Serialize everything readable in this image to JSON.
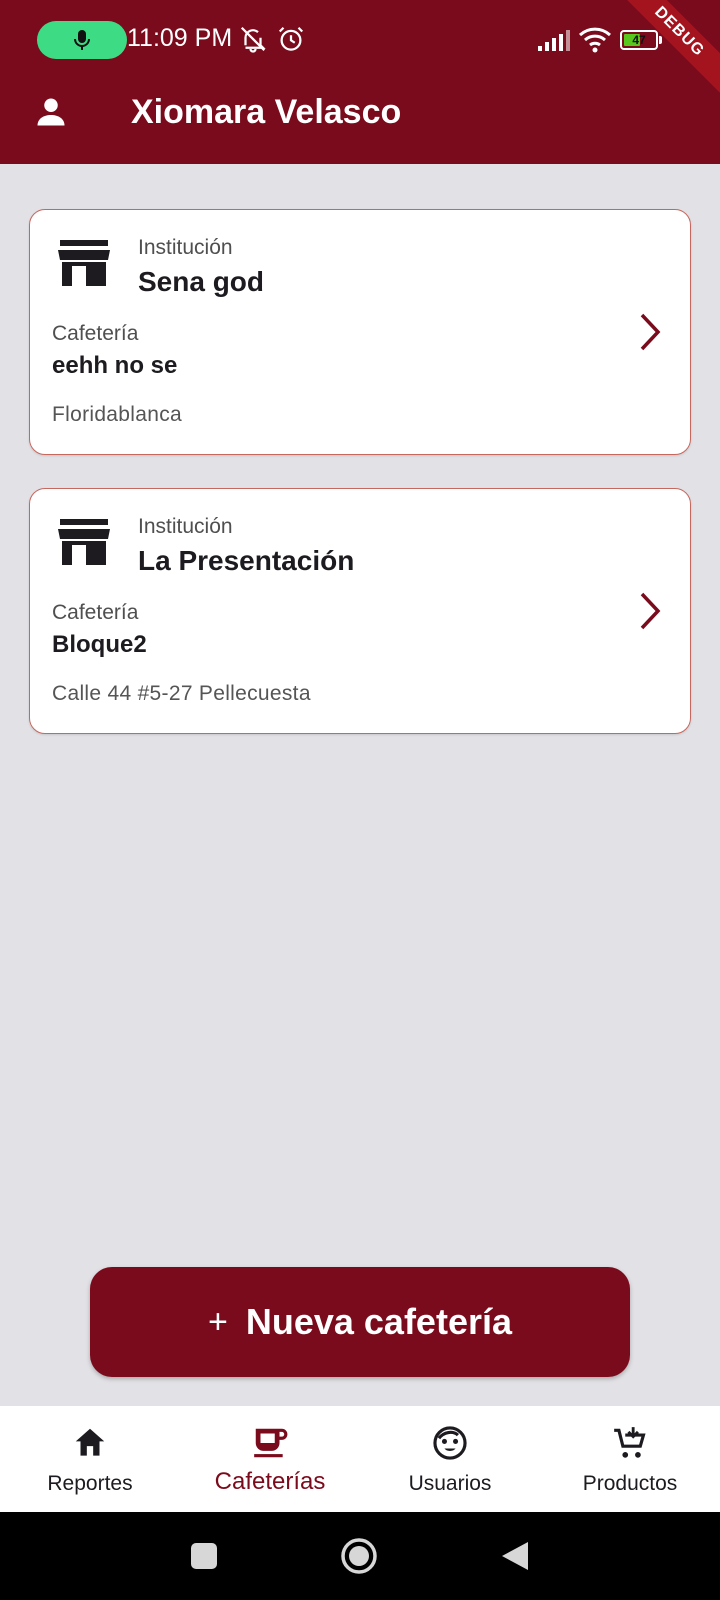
{
  "status_bar": {
    "time": "11:09 PM",
    "battery": "47",
    "battery_level": 47,
    "debug_banner": "DEBUG",
    "icons": [
      "mic-icon",
      "bell-off-icon",
      "alarm-icon",
      "signal-icon",
      "wifi-icon",
      "battery-icon"
    ]
  },
  "header": {
    "title": "Xiomara Velasco",
    "icon": "person-icon"
  },
  "cards": [
    {
      "institution_label": "Institución",
      "institution_name": "Sena god",
      "cafeteria_label": "Cafetería",
      "cafeteria_name": "eehh no se",
      "address": "Floridablanca"
    },
    {
      "institution_label": "Institución",
      "institution_name": "La Presentación",
      "cafeteria_label": "Cafetería",
      "cafeteria_name": "Bloque2",
      "address": "Calle 44 #5-27 Pellecuesta"
    }
  ],
  "new_button": {
    "plus": "+",
    "label": "Nueva cafetería"
  },
  "bottom_nav": {
    "items": [
      {
        "label": "Reportes",
        "icon": "home-icon"
      },
      {
        "label": "Cafeterías",
        "icon": "coffee-icon",
        "active": true
      },
      {
        "label": "Usuarios",
        "icon": "face-icon"
      },
      {
        "label": "Productos",
        "icon": "cart-icon"
      }
    ]
  },
  "colors": {
    "primary": "#7a0b1c",
    "background": "#e2e1e5",
    "card_border": "#c7685f",
    "mic_pill": "#3ddc84"
  }
}
